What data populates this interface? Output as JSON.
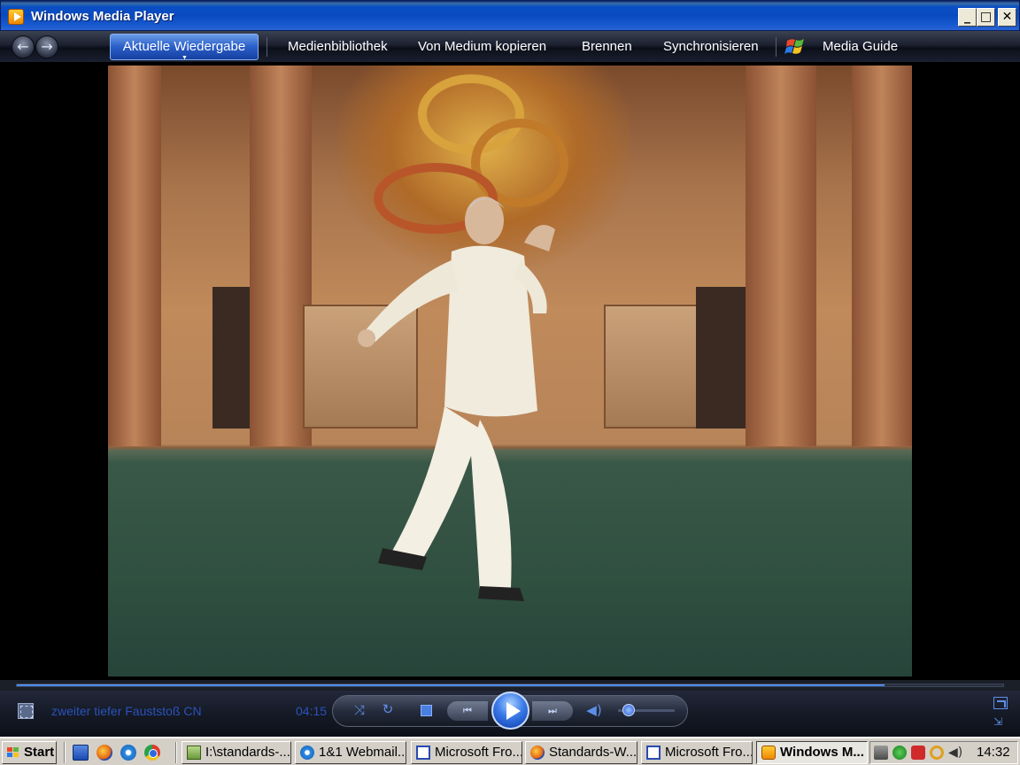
{
  "window": {
    "title": "Windows Media Player",
    "minimize_label": "_",
    "maximize_label": "□",
    "close_label": "✕"
  },
  "nav": {
    "back_label": "←",
    "forward_label": "→",
    "tabs": [
      {
        "label": "Aktuelle Wiedergabe",
        "active": true
      },
      {
        "label": "Medienbibliothek"
      },
      {
        "label": "Von Medium kopieren"
      },
      {
        "label": "Brennen"
      },
      {
        "label": "Synchronisieren"
      },
      {
        "label": "Media Guide"
      }
    ]
  },
  "player": {
    "track_title": "zweiter tiefer Fauststoß CN",
    "elapsed_time": "04:15",
    "seek_progress_percent": 88,
    "volume_percent": 10,
    "shuffle_label": "⤨",
    "repeat_label": "↻",
    "prev_label": "⏮",
    "next_label": "⏭",
    "mute_label": "◀)",
    "compact_label": "⇲"
  },
  "taskbar": {
    "start_label": "Start",
    "tasks": [
      {
        "label": "I:\\standards-...",
        "icon": "notepad-icon"
      },
      {
        "label": "1&1 Webmail...",
        "icon": "ie-icon"
      },
      {
        "label": "Microsoft Fro...",
        "icon": "frontpage-icon"
      },
      {
        "label": "Standards-W...",
        "icon": "firefox-icon"
      },
      {
        "label": "Microsoft Fro...",
        "icon": "frontpage-icon"
      },
      {
        "label": "Windows M...",
        "icon": "wmp-icon",
        "active": true
      }
    ],
    "clock": "14:32"
  },
  "colors": {
    "accent": "#2a52b8",
    "titlebar": "#0a4ac0",
    "taskbar": "#d4d0c8"
  }
}
